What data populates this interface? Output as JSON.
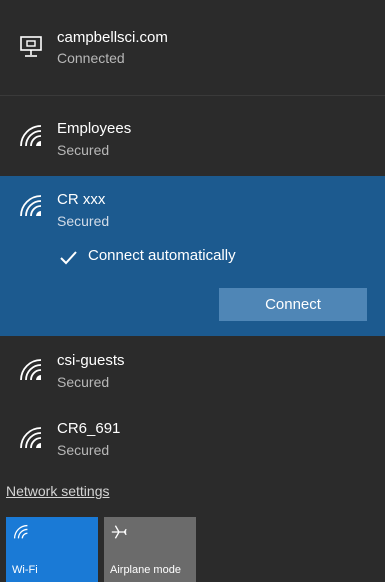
{
  "networks": [
    {
      "name": "campbellsci.com",
      "status": "Connected",
      "icon": "ethernet-icon"
    },
    {
      "name": "Employees",
      "status": "Secured",
      "icon": "wifi-icon"
    },
    {
      "name": "CR xxx",
      "status": "Secured",
      "icon": "wifi-icon",
      "selected": true
    },
    {
      "name": "csi-guests",
      "status": "Secured",
      "icon": "wifi-icon"
    },
    {
      "name": "CR6_691",
      "status": "Secured",
      "icon": "wifi-icon"
    }
  ],
  "selected_network": {
    "connect_automatically": {
      "label": "Connect automatically",
      "checked": true
    },
    "connect_button": "Connect"
  },
  "footer": {
    "network_settings": "Network settings"
  },
  "quick_actions": [
    {
      "label": "Wi-Fi",
      "icon": "wifi-icon",
      "active": true
    },
    {
      "label": "Airplane mode",
      "icon": "airplane-icon",
      "active": false
    }
  ],
  "colors": {
    "background": "#2b2b2b",
    "selected_background": "#1c5a8f",
    "connect_button": "#4f86b6",
    "wifi_tile": "#1a7ad6",
    "airplane_tile": "#6b6b6b",
    "status_text": "#b8b8b8"
  }
}
